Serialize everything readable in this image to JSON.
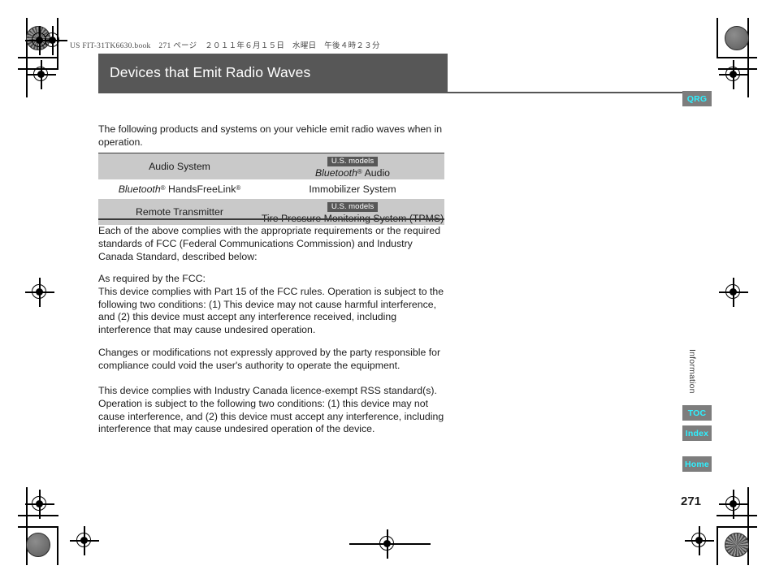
{
  "print_header": {
    "file_line": "US FIT-31TK6630.book　271 ページ　２０１１年６月１５日　水曜日　午後４時２３分"
  },
  "chapter": {
    "title": "Devices that Emit Radio Waves"
  },
  "body": {
    "intro": "The following products and systems on your vehicle emit radio waves when in operation.",
    "each_of_above": "Each of the above complies with the appropriate requirements or the required standards of FCC (Federal Communications Commission) and Industry Canada Standard, described below:",
    "fcc_heading": "As required by the FCC:",
    "fcc_body": "This device complies with Part 15 of the FCC rules. Operation is subject to the following two conditions: (1) This device may not cause harmful interference, and (2) this device must accept any interference received, including interference that may cause undesired operation.",
    "changes": "Changes or modifications not expressly approved by the party responsible for compliance could void the user's authority to operate the equipment.",
    "industry_canada": "This device complies with Industry Canada licence-exempt RSS standard(s). Operation is subject to the following two conditions: (1) this device may not cause interference, and (2) this device must accept any interference, including interference that may cause undesired operation of the device."
  },
  "device_table": {
    "badge_label": "U.S. models",
    "rows": [
      {
        "left": "Audio System",
        "right_prefix_italic": "Bluetooth",
        "right_suffix": " Audio",
        "has_badge": true,
        "shaded": true
      },
      {
        "left_prefix_italic": "Bluetooth",
        "left_suffix": " HandsFreeLink",
        "right": "Immobilizer System",
        "has_badge": false,
        "shaded": false
      },
      {
        "left": "Remote Transmitter",
        "right": "Tire Pressure Monitoring System (TPMS)",
        "has_badge": true,
        "shaded": true
      }
    ]
  },
  "rail": {
    "qrg": "QRG",
    "toc": "TOC",
    "index": "Index",
    "home": "Home",
    "section_tab": "Information",
    "page_number": "271"
  },
  "colors": {
    "title_bar": "#575757",
    "table_shade": "#c9c9c9",
    "rail_button_bg": "#7d7d7d",
    "rail_button_text": "#2ff0ff",
    "badge_bg": "#575757"
  }
}
